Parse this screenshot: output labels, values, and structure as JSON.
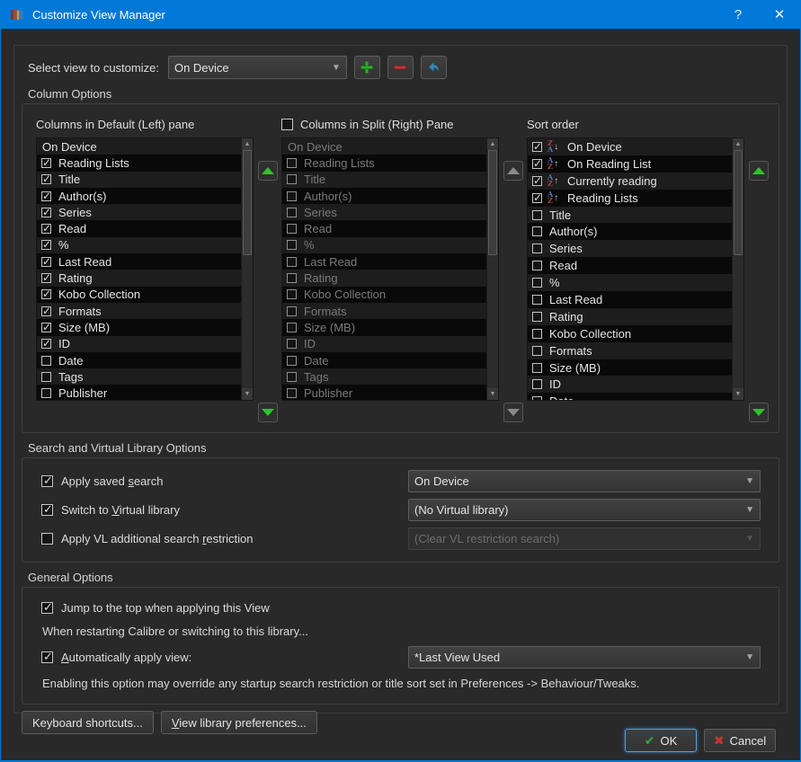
{
  "colors": {
    "titlebar": "#0078d7",
    "add_green": "#2bb02b",
    "remove_red": "#c43434",
    "rename_blue": "#3e86b0",
    "move_green": "#2ec22e",
    "ok_check_green": "#31a942",
    "cancel_x_red": "#c93434",
    "sort_letter_blue": "#5274bd",
    "sort_letter_red": "#a04338"
  },
  "window": {
    "title": "Customize View Manager",
    "help_glyph": "?",
    "close_glyph": "✕"
  },
  "view_selector": {
    "label": "Select view to customize:",
    "value": "On Device"
  },
  "column_options": {
    "title": "Column Options",
    "left_pane": {
      "label": "Columns in Default (Left) pane",
      "items": [
        {
          "label": "On Device",
          "header": true
        },
        {
          "label": "Reading Lists",
          "checked": true
        },
        {
          "label": "Title",
          "checked": true
        },
        {
          "label": "Author(s)",
          "checked": true
        },
        {
          "label": "Series",
          "checked": true
        },
        {
          "label": "Read",
          "checked": true
        },
        {
          "label": "%",
          "checked": true
        },
        {
          "label": "Last Read",
          "checked": true
        },
        {
          "label": "Rating",
          "checked": true
        },
        {
          "label": "Kobo Collection",
          "checked": true
        },
        {
          "label": "Formats",
          "checked": true
        },
        {
          "label": "Size (MB)",
          "checked": true
        },
        {
          "label": "ID",
          "checked": true
        },
        {
          "label": "Date",
          "checked": false
        },
        {
          "label": "Tags",
          "checked": false
        },
        {
          "label": "Publisher",
          "checked": false
        }
      ]
    },
    "right_pane": {
      "label": "Columns in Split (Right) Pane",
      "checked": false,
      "enabled": false,
      "items": [
        {
          "label": "On Device",
          "header": true
        },
        {
          "label": "Reading Lists",
          "checked": false
        },
        {
          "label": "Title",
          "checked": false
        },
        {
          "label": "Author(s)",
          "checked": false
        },
        {
          "label": "Series",
          "checked": false
        },
        {
          "label": "Read",
          "checked": false
        },
        {
          "label": "%",
          "checked": false
        },
        {
          "label": "Last Read",
          "checked": false
        },
        {
          "label": "Rating",
          "checked": false
        },
        {
          "label": "Kobo Collection",
          "checked": false
        },
        {
          "label": "Formats",
          "checked": false
        },
        {
          "label": "Size (MB)",
          "checked": false
        },
        {
          "label": "ID",
          "checked": false
        },
        {
          "label": "Date",
          "checked": false
        },
        {
          "label": "Tags",
          "checked": false
        },
        {
          "label": "Publisher",
          "checked": false
        }
      ]
    },
    "sort_pane": {
      "label": "Sort order",
      "items": [
        {
          "label": "On Device",
          "checked": true,
          "sort": "desc"
        },
        {
          "label": "On Reading List",
          "checked": true,
          "sort": "asc"
        },
        {
          "label": "Currently reading",
          "checked": true,
          "sort": "asc"
        },
        {
          "label": "Reading Lists",
          "checked": true,
          "sort": "asc"
        },
        {
          "label": "Title",
          "checked": false
        },
        {
          "label": "Author(s)",
          "checked": false
        },
        {
          "label": "Series",
          "checked": false
        },
        {
          "label": "Read",
          "checked": false
        },
        {
          "label": "%",
          "checked": false
        },
        {
          "label": "Last Read",
          "checked": false
        },
        {
          "label": "Rating",
          "checked": false
        },
        {
          "label": "Kobo Collection",
          "checked": false
        },
        {
          "label": "Formats",
          "checked": false
        },
        {
          "label": "Size (MB)",
          "checked": false
        },
        {
          "label": "ID",
          "checked": false
        },
        {
          "label": "Date",
          "checked": false
        }
      ]
    }
  },
  "search_options": {
    "title": "Search and Virtual Library Options",
    "rows": [
      {
        "checked": true,
        "label": {
          "pre": "Apply saved ",
          "key": "s",
          "post": "earch"
        },
        "combo": {
          "value": "On Device",
          "enabled": true
        }
      },
      {
        "checked": true,
        "label": {
          "pre": "Switch to ",
          "key": "V",
          "post": "irtual library"
        },
        "combo": {
          "value": "(No Virtual library)",
          "enabled": true
        }
      },
      {
        "checked": false,
        "label": {
          "pre": "Apply VL additional search ",
          "key": "r",
          "post": "estriction"
        },
        "combo": {
          "value": "(Clear VL restriction search)",
          "enabled": false
        }
      }
    ]
  },
  "general_options": {
    "title": "General Options",
    "jump": {
      "checked": true,
      "label": "Jump to the top when applying this View"
    },
    "restart_note": "When restarting Calibre or switching to this library...",
    "auto_apply": {
      "checked": true,
      "label": {
        "pre": "",
        "key": "A",
        "post": "utomatically apply view:"
      },
      "combo": {
        "value": "*Last View Used",
        "enabled": true
      }
    },
    "warning": "Enabling this option may override any startup search restriction or title sort set in Preferences -> Behaviour/Tweaks."
  },
  "footer": {
    "keyboard_shortcuts": "Keyboard shortcuts...",
    "view_prefs": {
      "pre": "",
      "key": "V",
      "post": "iew library preferences..."
    }
  },
  "dialog": {
    "ok_label": "OK",
    "cancel_label": "Cancel"
  }
}
